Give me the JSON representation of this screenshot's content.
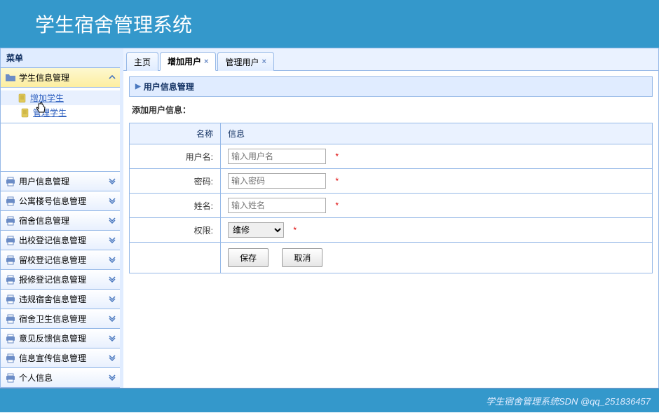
{
  "header": {
    "title": "学生宿舍管理系统"
  },
  "sidebar": {
    "title": "菜单",
    "expanded": {
      "label": "学生信息管理",
      "items": [
        {
          "label": "增加学生"
        },
        {
          "label": "管理学生"
        }
      ]
    },
    "collapsed": [
      "用户信息管理",
      "公寓楼号信息管理",
      "宿舍信息管理",
      "出校登记信息管理",
      "留校登记信息管理",
      "报修登记信息管理",
      "违规宿舍信息管理",
      "宿舍卫生信息管理",
      "意见反馈信息管理",
      "信息宣传信息管理",
      "个人信息"
    ]
  },
  "tabs": [
    {
      "label": "主页",
      "closable": false
    },
    {
      "label": "增加用户",
      "closable": true,
      "active": true
    },
    {
      "label": "管理用户",
      "closable": true
    }
  ],
  "panel": {
    "title": "用户信息管理"
  },
  "form": {
    "subtitle": "添加用户信息：",
    "head_name": "名称",
    "head_info": "信息",
    "rows": {
      "username": {
        "label": "用户名:",
        "placeholder": "输入用户名"
      },
      "password": {
        "label": "密码:",
        "placeholder": "输入密码"
      },
      "realname": {
        "label": "姓名:",
        "placeholder": "输入姓名"
      },
      "role": {
        "label": "权限:",
        "selected": "维修"
      }
    },
    "buttons": {
      "save": "保存",
      "cancel": "取消"
    },
    "required_mark": "*"
  },
  "footer": {
    "text": "学生宿舍管理系统SDN @qq_251836457"
  }
}
